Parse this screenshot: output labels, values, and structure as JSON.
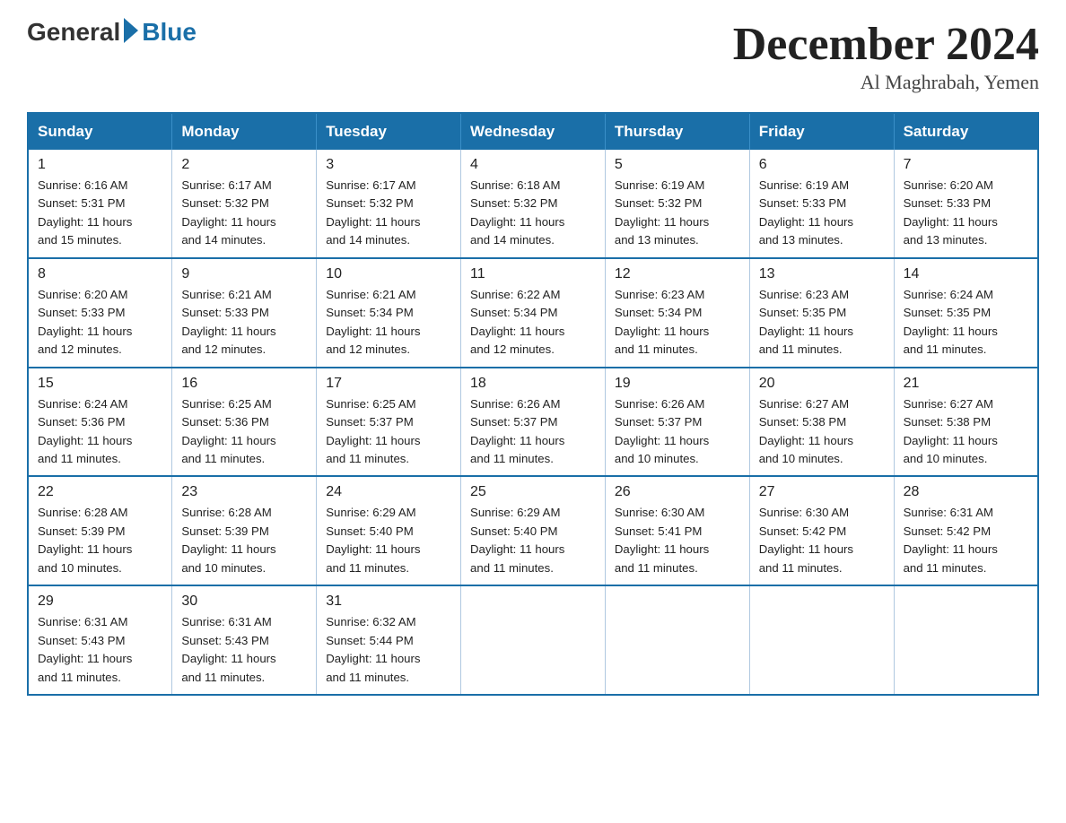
{
  "logo": {
    "general": "General",
    "blue": "Blue"
  },
  "header": {
    "month_year": "December 2024",
    "location": "Al Maghrabah, Yemen"
  },
  "days_of_week": [
    "Sunday",
    "Monday",
    "Tuesday",
    "Wednesday",
    "Thursday",
    "Friday",
    "Saturday"
  ],
  "weeks": [
    [
      {
        "day": "1",
        "sunrise": "6:16 AM",
        "sunset": "5:31 PM",
        "daylight": "11 hours and 15 minutes."
      },
      {
        "day": "2",
        "sunrise": "6:17 AM",
        "sunset": "5:32 PM",
        "daylight": "11 hours and 14 minutes."
      },
      {
        "day": "3",
        "sunrise": "6:17 AM",
        "sunset": "5:32 PM",
        "daylight": "11 hours and 14 minutes."
      },
      {
        "day": "4",
        "sunrise": "6:18 AM",
        "sunset": "5:32 PM",
        "daylight": "11 hours and 14 minutes."
      },
      {
        "day": "5",
        "sunrise": "6:19 AM",
        "sunset": "5:32 PM",
        "daylight": "11 hours and 13 minutes."
      },
      {
        "day": "6",
        "sunrise": "6:19 AM",
        "sunset": "5:33 PM",
        "daylight": "11 hours and 13 minutes."
      },
      {
        "day": "7",
        "sunrise": "6:20 AM",
        "sunset": "5:33 PM",
        "daylight": "11 hours and 13 minutes."
      }
    ],
    [
      {
        "day": "8",
        "sunrise": "6:20 AM",
        "sunset": "5:33 PM",
        "daylight": "11 hours and 12 minutes."
      },
      {
        "day": "9",
        "sunrise": "6:21 AM",
        "sunset": "5:33 PM",
        "daylight": "11 hours and 12 minutes."
      },
      {
        "day": "10",
        "sunrise": "6:21 AM",
        "sunset": "5:34 PM",
        "daylight": "11 hours and 12 minutes."
      },
      {
        "day": "11",
        "sunrise": "6:22 AM",
        "sunset": "5:34 PM",
        "daylight": "11 hours and 12 minutes."
      },
      {
        "day": "12",
        "sunrise": "6:23 AM",
        "sunset": "5:34 PM",
        "daylight": "11 hours and 11 minutes."
      },
      {
        "day": "13",
        "sunrise": "6:23 AM",
        "sunset": "5:35 PM",
        "daylight": "11 hours and 11 minutes."
      },
      {
        "day": "14",
        "sunrise": "6:24 AM",
        "sunset": "5:35 PM",
        "daylight": "11 hours and 11 minutes."
      }
    ],
    [
      {
        "day": "15",
        "sunrise": "6:24 AM",
        "sunset": "5:36 PM",
        "daylight": "11 hours and 11 minutes."
      },
      {
        "day": "16",
        "sunrise": "6:25 AM",
        "sunset": "5:36 PM",
        "daylight": "11 hours and 11 minutes."
      },
      {
        "day": "17",
        "sunrise": "6:25 AM",
        "sunset": "5:37 PM",
        "daylight": "11 hours and 11 minutes."
      },
      {
        "day": "18",
        "sunrise": "6:26 AM",
        "sunset": "5:37 PM",
        "daylight": "11 hours and 11 minutes."
      },
      {
        "day": "19",
        "sunrise": "6:26 AM",
        "sunset": "5:37 PM",
        "daylight": "11 hours and 10 minutes."
      },
      {
        "day": "20",
        "sunrise": "6:27 AM",
        "sunset": "5:38 PM",
        "daylight": "11 hours and 10 minutes."
      },
      {
        "day": "21",
        "sunrise": "6:27 AM",
        "sunset": "5:38 PM",
        "daylight": "11 hours and 10 minutes."
      }
    ],
    [
      {
        "day": "22",
        "sunrise": "6:28 AM",
        "sunset": "5:39 PM",
        "daylight": "11 hours and 10 minutes."
      },
      {
        "day": "23",
        "sunrise": "6:28 AM",
        "sunset": "5:39 PM",
        "daylight": "11 hours and 10 minutes."
      },
      {
        "day": "24",
        "sunrise": "6:29 AM",
        "sunset": "5:40 PM",
        "daylight": "11 hours and 11 minutes."
      },
      {
        "day": "25",
        "sunrise": "6:29 AM",
        "sunset": "5:40 PM",
        "daylight": "11 hours and 11 minutes."
      },
      {
        "day": "26",
        "sunrise": "6:30 AM",
        "sunset": "5:41 PM",
        "daylight": "11 hours and 11 minutes."
      },
      {
        "day": "27",
        "sunrise": "6:30 AM",
        "sunset": "5:42 PM",
        "daylight": "11 hours and 11 minutes."
      },
      {
        "day": "28",
        "sunrise": "6:31 AM",
        "sunset": "5:42 PM",
        "daylight": "11 hours and 11 minutes."
      }
    ],
    [
      {
        "day": "29",
        "sunrise": "6:31 AM",
        "sunset": "5:43 PM",
        "daylight": "11 hours and 11 minutes."
      },
      {
        "day": "30",
        "sunrise": "6:31 AM",
        "sunset": "5:43 PM",
        "daylight": "11 hours and 11 minutes."
      },
      {
        "day": "31",
        "sunrise": "6:32 AM",
        "sunset": "5:44 PM",
        "daylight": "11 hours and 11 minutes."
      },
      null,
      null,
      null,
      null
    ]
  ],
  "labels": {
    "sunrise": "Sunrise:",
    "sunset": "Sunset:",
    "daylight": "Daylight:"
  }
}
